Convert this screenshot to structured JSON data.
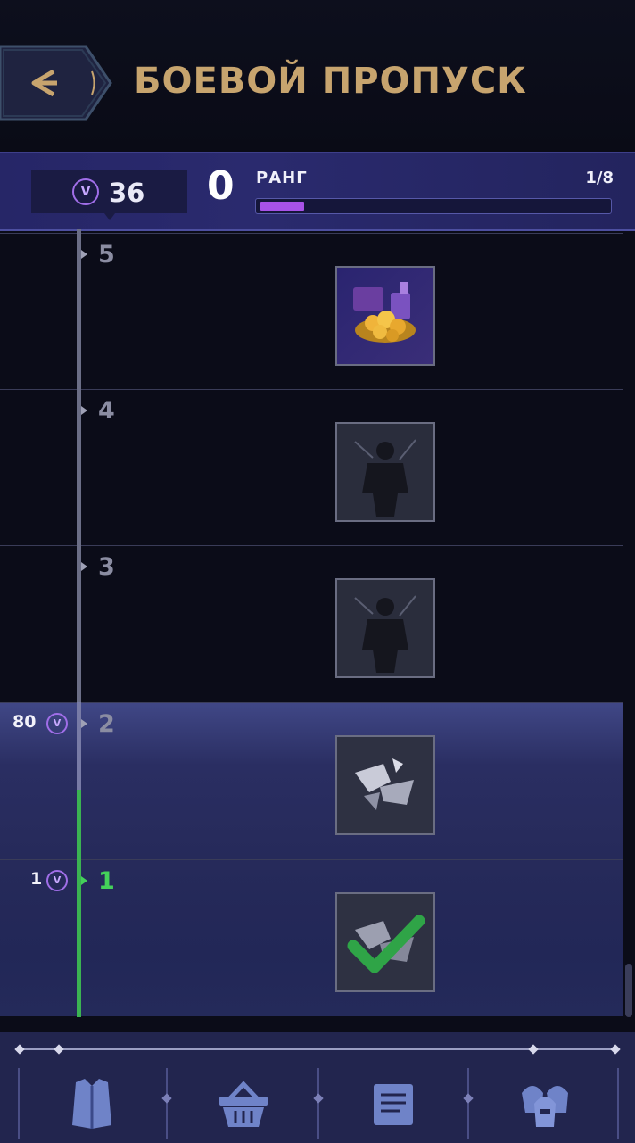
{
  "header": {
    "title": "БОЕВОЙ ПРОПУСК",
    "back_icon": "back-arrow-icon"
  },
  "rank_bar": {
    "currency_symbol": "V",
    "currency_value": "36",
    "rank_value": "0",
    "rank_label": "РАНГ",
    "rank_progress_text": "1/8",
    "rank_progress_fraction": 0.125,
    "progress_color": "#a852e8"
  },
  "tiers": [
    {
      "number": "5",
      "reward": "gold-treasure-icon"
    },
    {
      "number": "4",
      "reward": "locked-silhouette-icon"
    },
    {
      "number": "3",
      "reward": "locked-silhouette-icon"
    },
    {
      "number": "2",
      "cost": "80",
      "reward": "shattered-crystal-icon"
    },
    {
      "number": "1",
      "cost": "1",
      "reward": "claimed-crystal-icon",
      "claimed": true
    }
  ],
  "nav": [
    "armor-icon",
    "shop-basket-icon",
    "quest-scroll-icon",
    "heroes-helmets-icon"
  ],
  "colors": {
    "accent_gold": "#c7a46e",
    "active_green": "#44d05a",
    "panel": "#262667"
  }
}
